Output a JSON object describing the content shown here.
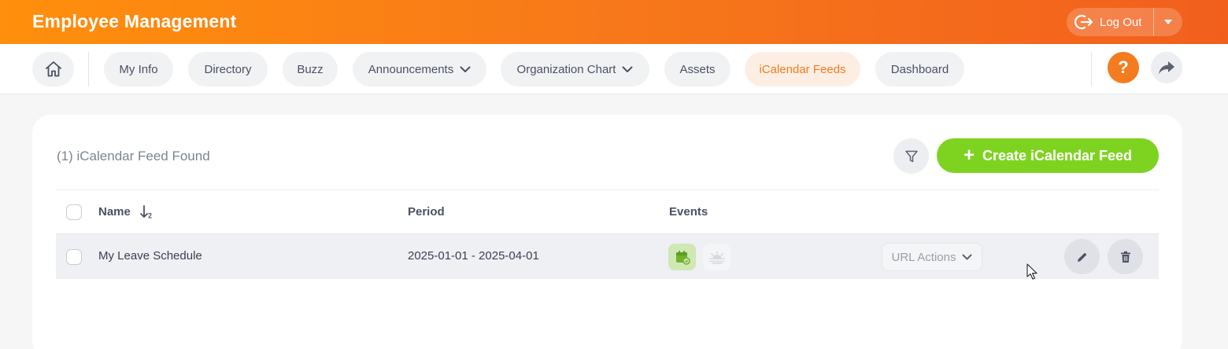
{
  "header": {
    "title": "Employee Management",
    "logout_label": "Log Out"
  },
  "nav": {
    "items": [
      {
        "label": "My Info"
      },
      {
        "label": "Directory"
      },
      {
        "label": "Buzz"
      },
      {
        "label": "Announcements",
        "has_dropdown": true
      },
      {
        "label": "Organization Chart",
        "has_dropdown": true
      },
      {
        "label": "Assets"
      },
      {
        "label": "iCalendar Feeds",
        "active": true
      },
      {
        "label": "Dashboard"
      }
    ],
    "help_label": "?"
  },
  "page": {
    "found_text": "(1) iCalendar Feed Found",
    "create_label": "Create iCalendar Feed",
    "create_icon": "+"
  },
  "table": {
    "columns": [
      "Name",
      "Period",
      "Events"
    ],
    "rows": [
      {
        "name": "My Leave Schedule",
        "period": "2025-01-01 - 2025-04-01",
        "events": [
          "leave-calendar-icon",
          "holiday-icon"
        ],
        "url_actions_label": "URL Actions"
      }
    ]
  },
  "colors": {
    "header_gradient_start": "#ff8f0c",
    "header_gradient_end": "#f25f1d",
    "accent_orange": "#f47b20",
    "create_green": "#7ed321",
    "active_tab_bg": "#fdeee3"
  }
}
